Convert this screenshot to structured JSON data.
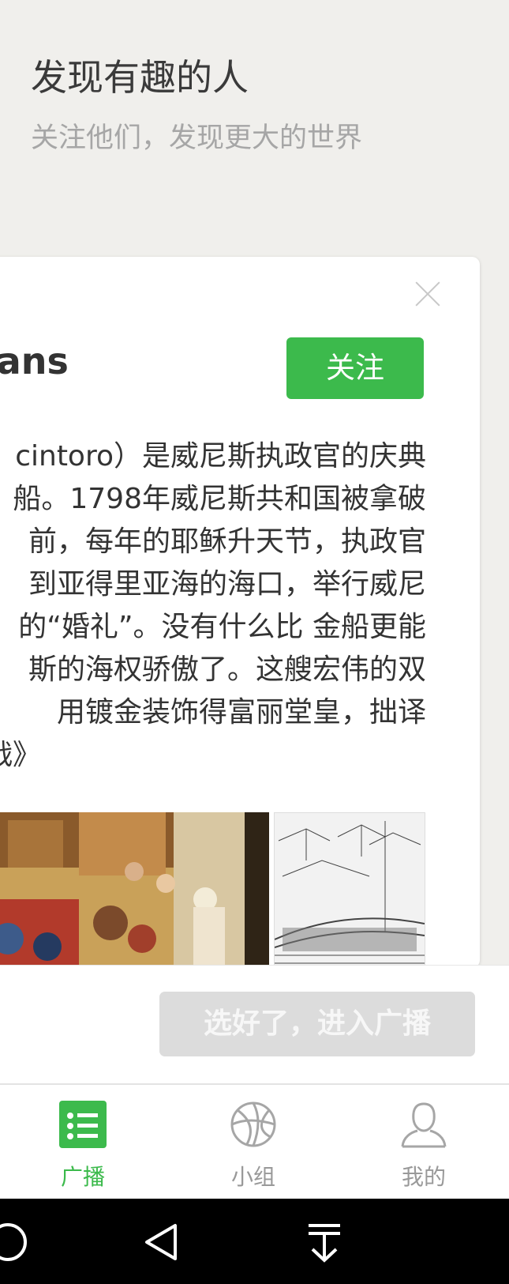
{
  "header": {
    "title": "发现有趣的人",
    "subtitle": "关注他们，发现更大的世界"
  },
  "card": {
    "name": "lans",
    "follow_label": "关注",
    "description_lines": [
      "cintoro）是威尼斯执政官的庆典",
      "船。1798年威尼斯共和国被拿破",
      "前，每年的耶稣升天节，执政官",
      "到亚得里亚海的海口，举行威尼",
      "的“婚礼”。没有什么比 金船更能",
      "斯的海权骄傲了。这艘宏伟的双",
      "用镀金装饰得富丽堂皇，拙译",
      "战》"
    ]
  },
  "bottom": {
    "enter_label": "选好了，进入广播"
  },
  "tabs": [
    {
      "label": "广播",
      "icon": "broadcast-list-icon",
      "active": true
    },
    {
      "label": "小组",
      "icon": "group-ball-icon",
      "active": false
    },
    {
      "label": "我的",
      "icon": "profile-person-icon",
      "active": false
    }
  ],
  "colors": {
    "accent": "#3cba4c",
    "background": "#f0efec",
    "disabled_button": "#dcdcdc",
    "inactive_tab": "#999999"
  },
  "navbar": {
    "icons": [
      "circle-home-icon",
      "back-triangle-icon",
      "download-arrow-icon"
    ]
  }
}
